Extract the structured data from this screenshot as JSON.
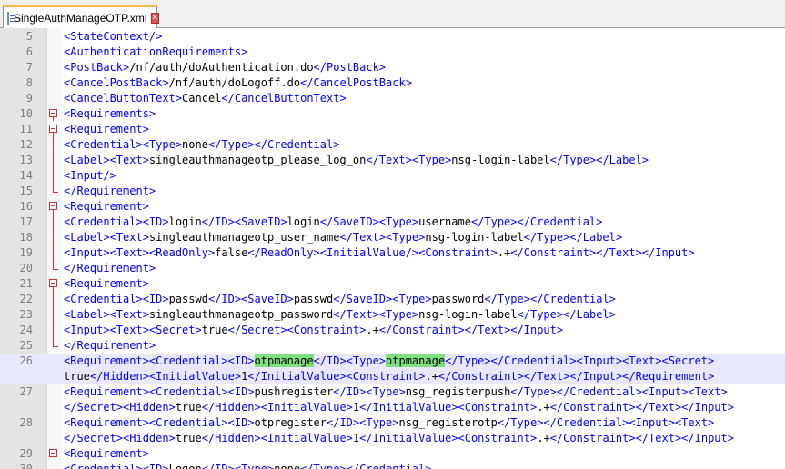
{
  "tab": {
    "title": "SingleAuthManageOTP.xml",
    "file_icon": "xml-file-icon",
    "close_icon": "close-icon"
  },
  "colors": {
    "tag": "#0000ff",
    "text": "#000000",
    "match_highlight": "#7fe07f",
    "fold_marker": "#cc3333",
    "current_line": "#e8e8ff"
  },
  "editor": {
    "lines": [
      {
        "num": "5",
        "spans": [
          [
            "t",
            "<StateContext/>"
          ]
        ]
      },
      {
        "num": "6",
        "spans": [
          [
            "t",
            "<AuthenticationRequirements>"
          ]
        ]
      },
      {
        "num": "7",
        "spans": [
          [
            "t",
            "<PostBack>"
          ],
          [
            "x",
            "/nf/auth/doAuthentication.do"
          ],
          [
            "t",
            "</PostBack>"
          ]
        ]
      },
      {
        "num": "8",
        "spans": [
          [
            "t",
            "<CancelPostBack>"
          ],
          [
            "x",
            "/nf/auth/doLogoff.do"
          ],
          [
            "t",
            "</CancelPostBack>"
          ]
        ]
      },
      {
        "num": "9",
        "spans": [
          [
            "t",
            "<CancelButtonText>"
          ],
          [
            "x",
            "Cancel"
          ],
          [
            "t",
            "</CancelButtonText>"
          ]
        ]
      },
      {
        "num": "10",
        "spans": [
          [
            "t",
            "<Requirements>"
          ]
        ]
      },
      {
        "num": "11",
        "spans": [
          [
            "t",
            "<Requirement>"
          ]
        ]
      },
      {
        "num": "12",
        "spans": [
          [
            "t",
            "<Credential><Type>"
          ],
          [
            "x",
            "none"
          ],
          [
            "t",
            "</Type></Credential>"
          ]
        ]
      },
      {
        "num": "13",
        "spans": [
          [
            "t",
            "<Label><Text>"
          ],
          [
            "x",
            "singleauthmanageotp_please_log_on"
          ],
          [
            "t",
            "</Text><Type>"
          ],
          [
            "x",
            "nsg-login-label"
          ],
          [
            "t",
            "</Type></Label>"
          ]
        ]
      },
      {
        "num": "14",
        "spans": [
          [
            "t",
            "<Input/>"
          ]
        ]
      },
      {
        "num": "15",
        "spans": [
          [
            "t",
            "</Requirement>"
          ]
        ]
      },
      {
        "num": "16",
        "spans": [
          [
            "t",
            "<Requirement>"
          ]
        ]
      },
      {
        "num": "17",
        "spans": [
          [
            "t",
            "<Credential><ID>"
          ],
          [
            "x",
            "login"
          ],
          [
            "t",
            "</ID><SaveID>"
          ],
          [
            "x",
            "login"
          ],
          [
            "t",
            "</SaveID><Type>"
          ],
          [
            "x",
            "username"
          ],
          [
            "t",
            "</Type></Credential>"
          ]
        ]
      },
      {
        "num": "18",
        "spans": [
          [
            "t",
            "<Label><Text>"
          ],
          [
            "x",
            "singleauthmanageotp_user_name"
          ],
          [
            "t",
            "</Text><Type>"
          ],
          [
            "x",
            "nsg-login-label"
          ],
          [
            "t",
            "</Type></Label>"
          ]
        ]
      },
      {
        "num": "19",
        "spans": [
          [
            "t",
            "<Input><Text><ReadOnly>"
          ],
          [
            "x",
            "false"
          ],
          [
            "t",
            "</ReadOnly><InitialValue/><Constraint>"
          ],
          [
            "x",
            ".+"
          ],
          [
            "t",
            "</Constraint></Text></Input>"
          ]
        ]
      },
      {
        "num": "20",
        "spans": [
          [
            "t",
            "</Requirement>"
          ]
        ]
      },
      {
        "num": "21",
        "spans": [
          [
            "t",
            "<Requirement>"
          ]
        ]
      },
      {
        "num": "22",
        "spans": [
          [
            "t",
            "<Credential><ID>"
          ],
          [
            "x",
            "passwd"
          ],
          [
            "t",
            "</ID><SaveID>"
          ],
          [
            "x",
            "passwd"
          ],
          [
            "t",
            "</SaveID><Type>"
          ],
          [
            "x",
            "password"
          ],
          [
            "t",
            "</Type></Credential>"
          ]
        ]
      },
      {
        "num": "23",
        "spans": [
          [
            "t",
            "<Label><Text>"
          ],
          [
            "x",
            "singleauthmanageotp_password"
          ],
          [
            "t",
            "</Text><Type>"
          ],
          [
            "x",
            "nsg-login-label"
          ],
          [
            "t",
            "</Type></Label>"
          ]
        ]
      },
      {
        "num": "24",
        "spans": [
          [
            "t",
            "<Input><Text><Secret>"
          ],
          [
            "x",
            "true"
          ],
          [
            "t",
            "</Secret><Constraint>"
          ],
          [
            "x",
            ".+"
          ],
          [
            "t",
            "</Constraint></Text></Input>"
          ]
        ]
      },
      {
        "num": "25",
        "spans": [
          [
            "t",
            "</Requirement>"
          ]
        ]
      },
      {
        "num": "26",
        "spans": [
          [
            "t",
            "<Requirement><Credential><ID>"
          ],
          [
            "m",
            "otpmanage"
          ],
          [
            "t",
            "</ID><Type>"
          ],
          [
            "m",
            "otpmanage"
          ],
          [
            "t",
            "</Type></Credential><Input><Text><Secret>"
          ]
        ]
      },
      {
        "num": "",
        "spans": [
          [
            "x",
            "true"
          ],
          [
            "t",
            "</Hidden><InitialValue>"
          ],
          [
            "x",
            "1"
          ],
          [
            "t",
            "</InitialValue><Constraint>"
          ],
          [
            "x",
            ".+"
          ],
          [
            "t",
            "</Constraint></Text></Input></Requirement>"
          ]
        ]
      },
      {
        "num": "27",
        "spans": [
          [
            "t",
            "<Requirement><Credential><ID>"
          ],
          [
            "x",
            "pushregister"
          ],
          [
            "t",
            "</ID><Type>"
          ],
          [
            "x",
            "nsg_registerpush"
          ],
          [
            "t",
            "</Type></Credential><Input><Text>"
          ]
        ]
      },
      {
        "num": "",
        "spans": [
          [
            "t",
            "</Secret><Hidden>"
          ],
          [
            "x",
            "true"
          ],
          [
            "t",
            "</Hidden><InitialValue>"
          ],
          [
            "x",
            "1"
          ],
          [
            "t",
            "</InitialValue><Constraint>"
          ],
          [
            "x",
            ".+"
          ],
          [
            "t",
            "</Constraint></Text></Input>"
          ]
        ]
      },
      {
        "num": "28",
        "spans": [
          [
            "t",
            "<Requirement><Credential><ID>"
          ],
          [
            "x",
            "otpregister"
          ],
          [
            "t",
            "</ID><Type>"
          ],
          [
            "x",
            "nsg_registerotp"
          ],
          [
            "t",
            "</Type></Credential><Input><Text>"
          ]
        ]
      },
      {
        "num": "",
        "spans": [
          [
            "t",
            "</Secret><Hidden>"
          ],
          [
            "x",
            "true"
          ],
          [
            "t",
            "</Hidden><InitialValue>"
          ],
          [
            "x",
            "1"
          ],
          [
            "t",
            "</InitialValue><Constraint>"
          ],
          [
            "x",
            ".+"
          ],
          [
            "t",
            "</Constraint></Text></Input>"
          ]
        ]
      },
      {
        "num": "29",
        "spans": [
          [
            "t",
            "<Requirement>"
          ]
        ]
      },
      {
        "num": "30",
        "spans": [
          [
            "t",
            "<Credential><ID>"
          ],
          [
            "x",
            "Logon"
          ],
          [
            "t",
            "</ID><Type>"
          ],
          [
            "x",
            "none"
          ],
          [
            "t",
            "</Type></Credential>"
          ]
        ]
      }
    ]
  }
}
